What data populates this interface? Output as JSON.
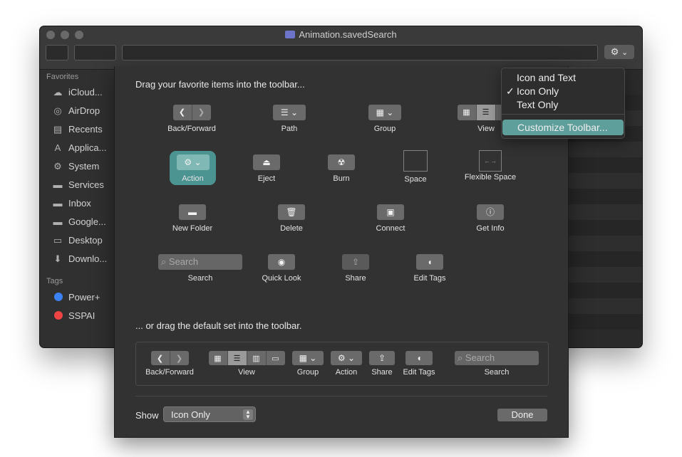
{
  "window": {
    "title": "Animation.savedSearch"
  },
  "sidebar": {
    "favorites_header": "Favorites",
    "items": [
      {
        "label": "iCloud...",
        "icon": "cloud-icon",
        "glyph": "☁"
      },
      {
        "label": "AirDrop",
        "icon": "airdrop-icon",
        "glyph": "◎"
      },
      {
        "label": "Recents",
        "icon": "recents-icon",
        "glyph": "▤"
      },
      {
        "label": "Applica...",
        "icon": "applications-icon",
        "glyph": "A"
      },
      {
        "label": "System",
        "icon": "gear-icon",
        "glyph": "⚙"
      },
      {
        "label": "Services",
        "icon": "folder-icon",
        "glyph": "▬"
      },
      {
        "label": "Inbox",
        "icon": "folder-icon",
        "glyph": "▬"
      },
      {
        "label": "Google...",
        "icon": "folder-icon",
        "glyph": "▬"
      },
      {
        "label": "Desktop",
        "icon": "desktop-icon",
        "glyph": "▭"
      },
      {
        "label": "Downlo...",
        "icon": "download-icon",
        "glyph": "⬇"
      }
    ],
    "tags_header": "Tags",
    "tags": [
      {
        "label": "Power+",
        "color": "#3b82f6"
      },
      {
        "label": "SSPAI",
        "color": "#ef4444"
      }
    ]
  },
  "sheet": {
    "heading": "Drag your favorite items into the toolbar...",
    "default_heading": "... or drag the default set into the toolbar.",
    "items": {
      "back_forward": "Back/Forward",
      "path": "Path",
      "group": "Group",
      "view": "View",
      "action": "Action",
      "eject": "Eject",
      "burn": "Burn",
      "space": "Space",
      "flexible_space": "Flexible Space",
      "new_folder": "New Folder",
      "delete": "Delete",
      "connect": "Connect",
      "get_info": "Get Info",
      "search": "Search",
      "search_placeholder": "Search",
      "quick_look": "Quick Look",
      "share": "Share",
      "edit_tags": "Edit Tags"
    },
    "default_set": {
      "back_forward": "Back/Forward",
      "view": "View",
      "group": "Group",
      "action": "Action",
      "share": "Share",
      "edit_tags": "Edit Tags",
      "search": "Search",
      "search_placeholder": "Search"
    },
    "show_label": "Show",
    "show_value": "Icon Only",
    "done_label": "Done"
  },
  "menu": {
    "items": [
      {
        "label": "Icon and Text",
        "checked": false
      },
      {
        "label": "Icon Only",
        "checked": true
      },
      {
        "label": "Text Only",
        "checked": false
      }
    ],
    "customize": "Customize Toolbar...",
    "checkmark": "✓"
  },
  "accent_color": "#5e9e9b"
}
